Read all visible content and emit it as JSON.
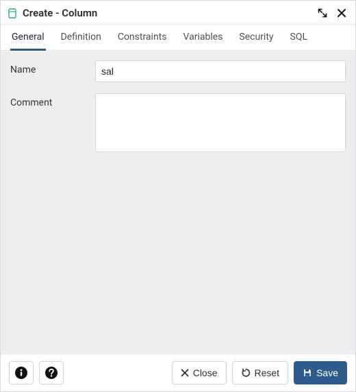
{
  "titlebar": {
    "title": "Create - Column"
  },
  "tabs": [
    {
      "label": "General",
      "active": true
    },
    {
      "label": "Definition",
      "active": false
    },
    {
      "label": "Constraints",
      "active": false
    },
    {
      "label": "Variables",
      "active": false
    },
    {
      "label": "Security",
      "active": false
    },
    {
      "label": "SQL",
      "active": false
    }
  ],
  "form": {
    "name_label": "Name",
    "name_value": "sal",
    "comment_label": "Comment",
    "comment_value": ""
  },
  "footer": {
    "close_label": "Close",
    "reset_label": "Reset",
    "save_label": "Save"
  }
}
